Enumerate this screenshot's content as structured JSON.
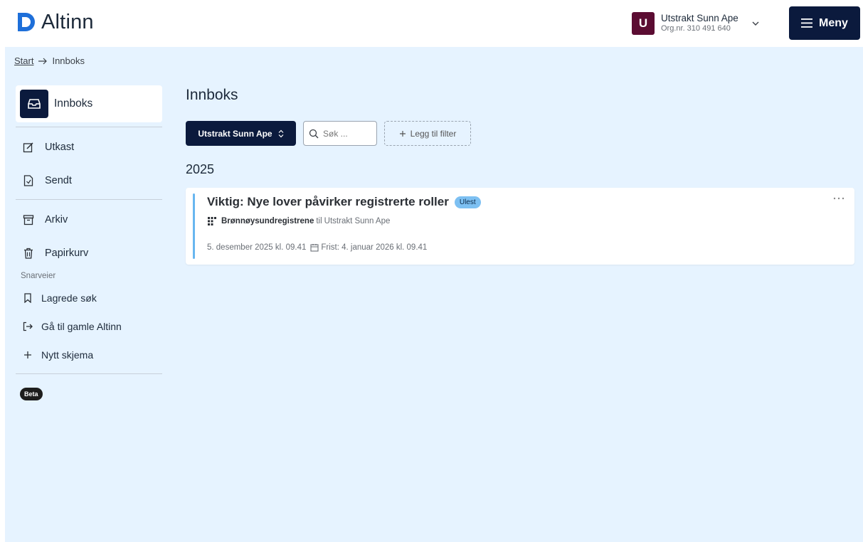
{
  "brand": {
    "name": "Altinn",
    "accent": "#0b1a3d",
    "logo_color": "#1e6fd9"
  },
  "account": {
    "initial": "U",
    "name": "Utstrakt Sunn Ape",
    "org": "Org.nr. 310 491 640",
    "avatar_color": "#5b0c32"
  },
  "header": {
    "menu_label": "Meny"
  },
  "breadcrumb": {
    "start": "Start",
    "current": "Innboks"
  },
  "sidebar": {
    "active": {
      "label": "Innboks",
      "icon": "inbox-icon"
    },
    "items": [
      {
        "label": "Utkast",
        "icon": "edit-icon"
      },
      {
        "label": "Sendt",
        "icon": "sent-file-icon"
      },
      {
        "label": "Arkiv",
        "icon": "archive-icon"
      },
      {
        "label": "Papirkurv",
        "icon": "trash-icon"
      }
    ],
    "shortcuts_label": "Snarveier",
    "shortcuts": [
      {
        "label": "Lagrede søk",
        "icon": "bookmark-icon"
      },
      {
        "label": "Gå til gamle Altinn",
        "icon": "exit-arrow-icon"
      },
      {
        "label": "Nytt skjema",
        "icon": "plus-icon"
      }
    ],
    "beta_label": "Beta"
  },
  "main": {
    "title": "Innboks",
    "filters": {
      "org_select": "Utstrakt Sunn Ape",
      "search_placeholder": "Søk ...",
      "add_filter": "Legg til filter"
    },
    "year": "2025",
    "messages": [
      {
        "title": "Viktig: Nye lover påvirker registrerte roller",
        "badge": "Ulest",
        "sender": "Brønnøysundregistrene",
        "to_word": "til",
        "recipient": "Utstrakt Sunn Ape",
        "date": "5. desember 2025 kl. 09.41",
        "due": "Frist: 4. januar 2026 kl. 09.41"
      }
    ]
  }
}
